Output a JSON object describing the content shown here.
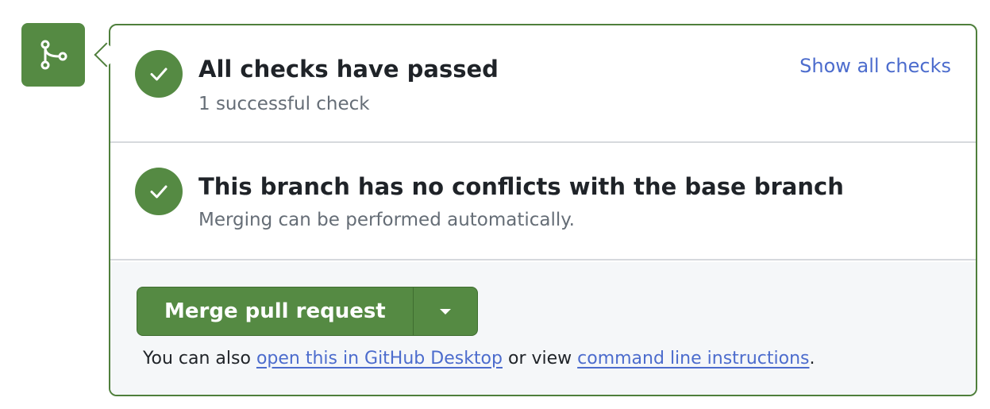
{
  "merge_icon": "git-merge-icon",
  "colors": {
    "success": "#558a43",
    "border": "#4f7f3c",
    "link": "#4c6ccd",
    "muted": "#656d76",
    "text": "#1f2328"
  },
  "checks": {
    "icon": "check-icon",
    "title": "All checks have passed",
    "subtitle": "1 successful check",
    "show_all_label": "Show all checks"
  },
  "conflicts": {
    "icon": "check-icon",
    "title": "This branch has no conflicts with the base branch",
    "subtitle": "Merging can be performed automatically."
  },
  "merge": {
    "button_label": "Merge pull request",
    "dropdown_icon": "caret-down-icon",
    "also_prefix": "You can also ",
    "desktop_link": "open this in GitHub Desktop",
    "also_middle": " or view ",
    "cli_link": "command line instructions",
    "also_suffix": "."
  }
}
